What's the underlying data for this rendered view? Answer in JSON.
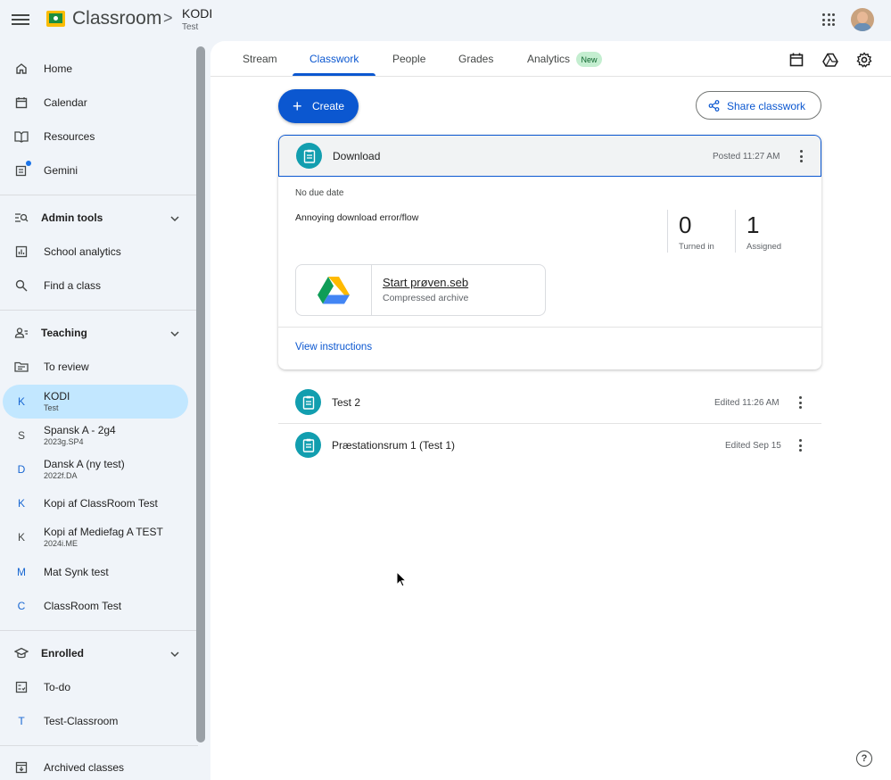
{
  "header": {
    "app_title": "Classroom",
    "breadcrumb_sep": ">",
    "class_name": "KODI",
    "class_section": "Test"
  },
  "sidebar": {
    "items": [
      {
        "label": "Home",
        "icon": "home-icon"
      },
      {
        "label": "Calendar",
        "icon": "calendar-icon"
      },
      {
        "label": "Resources",
        "icon": "book-icon"
      },
      {
        "label": "Gemini",
        "icon": "gemini-icon"
      }
    ],
    "admin_tools": {
      "label": "Admin tools",
      "items": [
        {
          "label": "School analytics",
          "icon": "analytics-icon"
        },
        {
          "label": "Find a class",
          "icon": "search-icon"
        }
      ]
    },
    "teaching": {
      "label": "Teaching",
      "to_review": "To review",
      "classes": [
        {
          "letter": "K",
          "name": "KODI",
          "section": "Test",
          "color": "#1967d2"
        },
        {
          "letter": "S",
          "name": "Spansk A - 2g4",
          "section": "2023g.SP4",
          "color": "#444746"
        },
        {
          "letter": "D",
          "name": "Dansk A (ny test)",
          "section": "2022f.DA",
          "color": "#1967d2"
        },
        {
          "letter": "K",
          "name": "Kopi af ClassRoom Test",
          "section": "",
          "color": "#1967d2"
        },
        {
          "letter": "K",
          "name": "Kopi af Mediefag A TEST",
          "section": "2024i.ME",
          "color": "#444746"
        },
        {
          "letter": "M",
          "name": "Mat Synk test",
          "section": "",
          "color": "#1967d2"
        },
        {
          "letter": "C",
          "name": "ClassRoom Test",
          "section": "",
          "color": "#1967d2"
        }
      ]
    },
    "enrolled": {
      "label": "Enrolled",
      "todo": "To-do",
      "classes": [
        {
          "letter": "T",
          "name": "Test-Classroom",
          "section": "",
          "color": "#1967d2"
        }
      ]
    },
    "archived": "Archived classes"
  },
  "tabs": [
    {
      "label": "Stream"
    },
    {
      "label": "Classwork"
    },
    {
      "label": "People"
    },
    {
      "label": "Grades"
    },
    {
      "label": "Analytics"
    }
  ],
  "new_badge": "New",
  "toolbar": {
    "create_label": "Create",
    "share_label": "Share classwork"
  },
  "expanded_assignment": {
    "title": "Download",
    "posted": "Posted 11:27 AM",
    "due": "No due date",
    "description": "Annoying download error/flow",
    "turned_in_count": "0",
    "turned_in_label": "Turned in",
    "assigned_count": "1",
    "assigned_label": "Assigned",
    "attachment": {
      "title": "Start prøven.seb",
      "subtitle": "Compressed archive"
    },
    "view_instructions": "View instructions"
  },
  "assignments": [
    {
      "title": "Test 2",
      "meta": "Edited 11:26 AM"
    },
    {
      "title": "Præstationsrum 1 (Test 1)",
      "meta": "Edited Sep 15"
    }
  ],
  "help": "?"
}
